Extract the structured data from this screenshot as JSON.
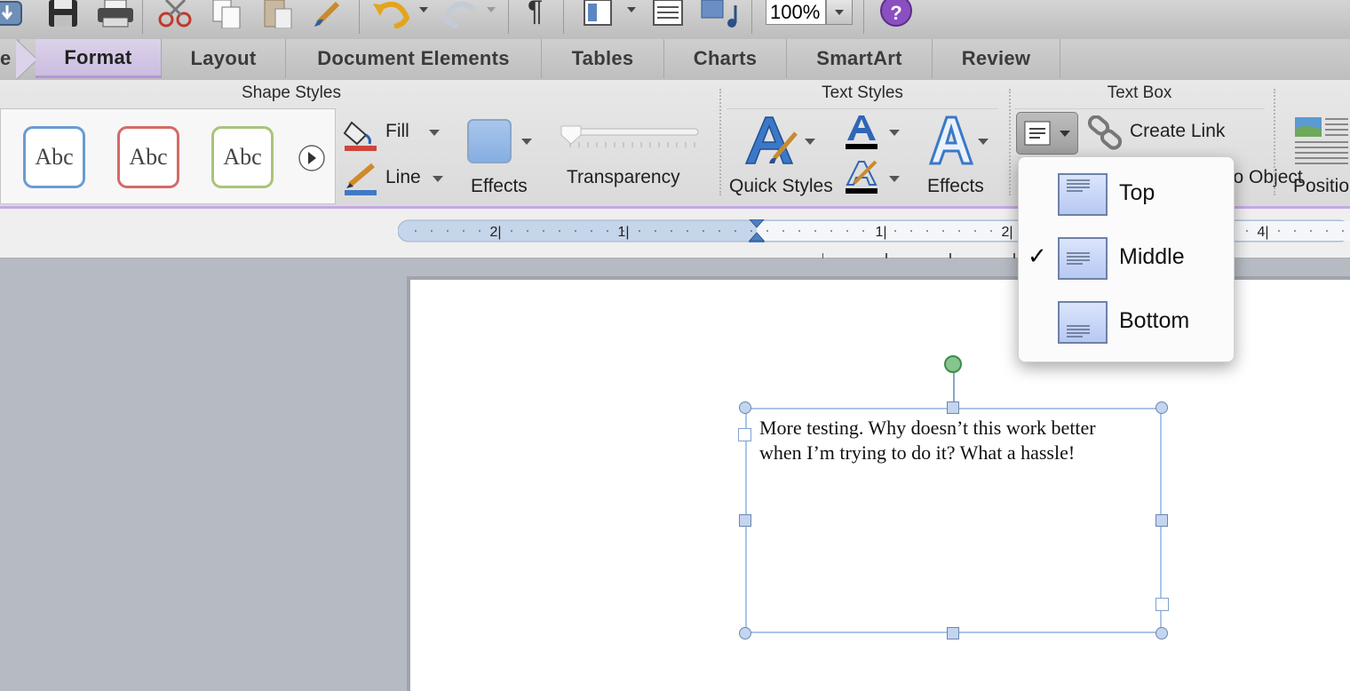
{
  "toolbar": {
    "zoom_value": "100%",
    "icons": [
      "save-icon",
      "print-icon",
      "cut-icon",
      "copy-icon",
      "paste-icon",
      "format-painter-icon",
      "undo-icon",
      "redo-icon",
      "paragraph-marks-icon",
      "view-layout-icon",
      "toolbox-icon",
      "media-browser-icon",
      "zoom-dropdown-icon",
      "help-icon"
    ]
  },
  "tabs": [
    {
      "label": "e"
    },
    {
      "label": "Format"
    },
    {
      "label": "Layout"
    },
    {
      "label": "Document Elements"
    },
    {
      "label": "Tables"
    },
    {
      "label": "Charts"
    },
    {
      "label": "SmartArt"
    },
    {
      "label": "Review"
    }
  ],
  "ribbon": {
    "shape_styles": {
      "title": "Shape Styles",
      "styles": [
        {
          "label": "Abc",
          "border": "#6a9bd3"
        },
        {
          "label": "Abc",
          "border": "#d56a65"
        },
        {
          "label": "Abc",
          "border": "#a8c47a"
        }
      ],
      "fill_label": "Fill",
      "line_label": "Line",
      "effects_label": "Effects",
      "transparency_label": "Transparency",
      "transparency_value": 0
    },
    "text_styles": {
      "title": "Text Styles",
      "quick_styles_label": "Quick Styles",
      "effects_label": "Effects"
    },
    "text_box": {
      "title": "Text Box",
      "create_link_label": "Create Link",
      "break_link_partial": "Break to Object",
      "position_label": "Positio"
    }
  },
  "ruler": {
    "labels": [
      "2",
      "1",
      "1",
      "2",
      "4"
    ]
  },
  "document": {
    "textbox_text": "More testing.  Why doesn’t this work better when I’m trying to do it?  What a hassle!"
  },
  "alignment_menu": {
    "items": [
      {
        "label": "Top",
        "checked": false
      },
      {
        "label": "Middle",
        "checked": true
      },
      {
        "label": "Bottom",
        "checked": false
      }
    ],
    "check_glyph": "✓"
  },
  "colors": {
    "accent_tab": "#cbbde0",
    "selection_border": "#a9c6e8",
    "rotate_handle": "#6fbf7a"
  }
}
